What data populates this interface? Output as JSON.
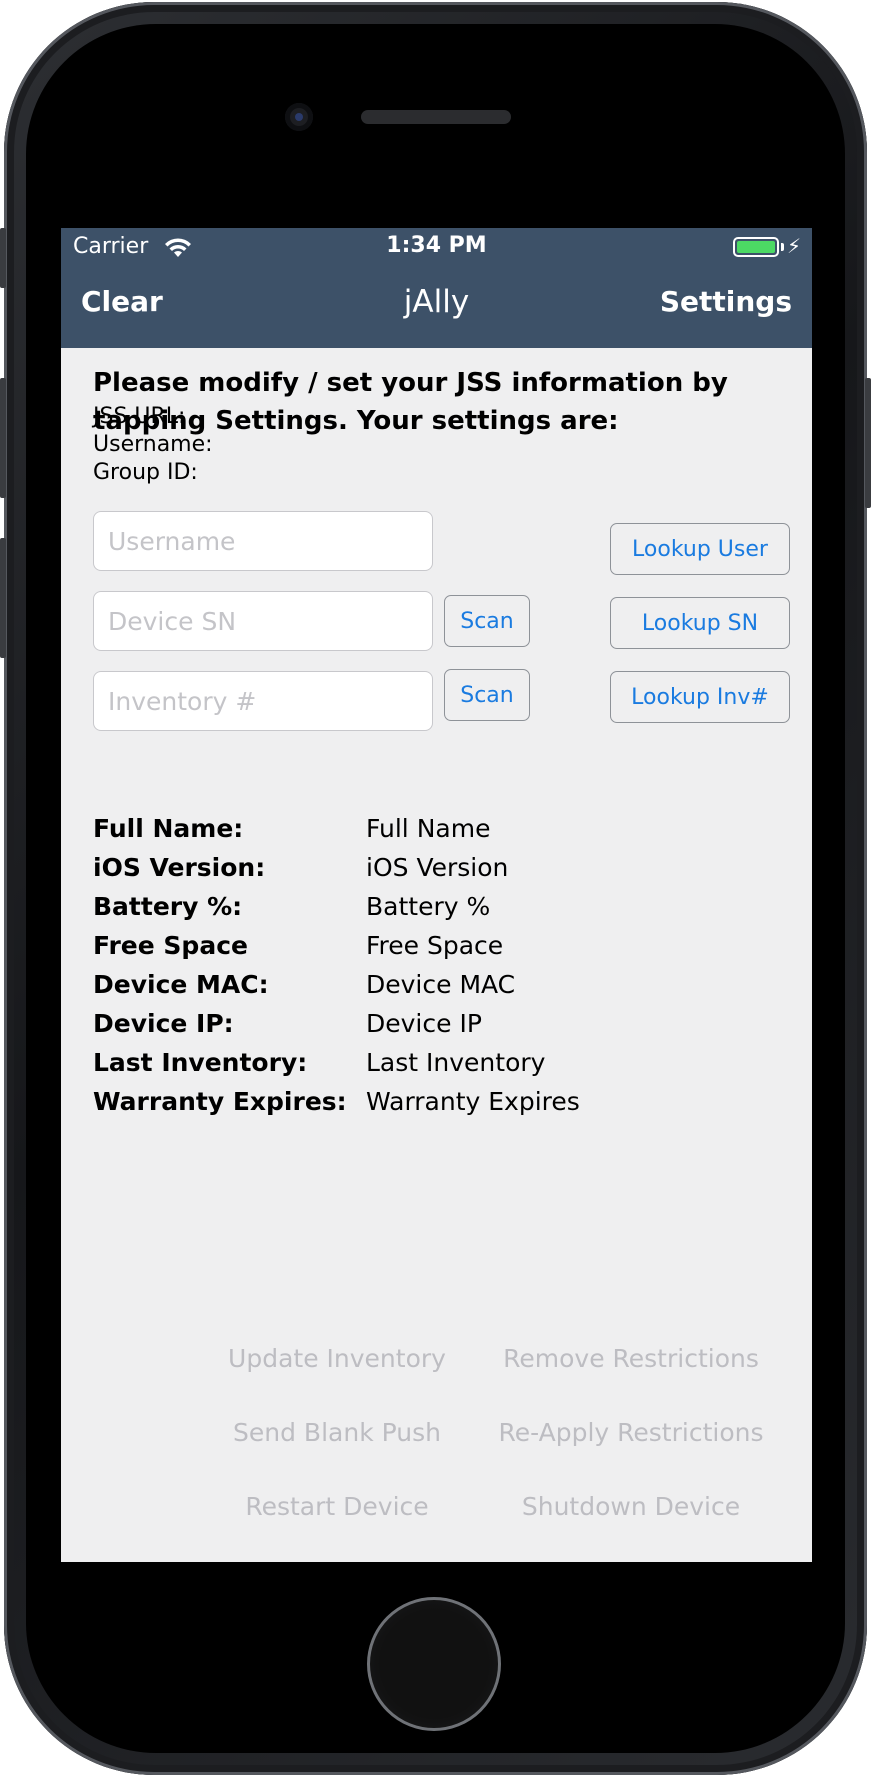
{
  "status_bar": {
    "carrier": "Carrier",
    "time": "1:34 PM",
    "battery_level": 1.0,
    "charging": true
  },
  "nav": {
    "left_button": "Clear",
    "title": "jAlly",
    "right_button": "Settings"
  },
  "intro": {
    "text": "Please modify / set your JSS information by tapping Settings. Your settings are:"
  },
  "settings": {
    "jss_url_label": "JSS URL:",
    "username_label": "Username:",
    "group_id_label": "Group ID:"
  },
  "lookup": {
    "username_placeholder": "Username",
    "device_sn_placeholder": "Device SN",
    "inventory_placeholder": "Inventory #",
    "scan_label": "Scan",
    "lookup_user_label": "Lookup User",
    "lookup_sn_label": "Lookup SN",
    "lookup_inv_label": "Lookup Inv#"
  },
  "device_info": [
    {
      "label": "Full Name:",
      "value": "Full Name"
    },
    {
      "label": "iOS Version:",
      "value": "iOS Version"
    },
    {
      "label": "Battery %:",
      "value": "Battery %"
    },
    {
      "label": "Free Space",
      "value": "Free Space"
    },
    {
      "label": "Device MAC:",
      "value": "Device MAC"
    },
    {
      "label": "Device IP:",
      "value": "Device IP"
    },
    {
      "label": "Last Inventory:",
      "value": "Last Inventory"
    },
    {
      "label": "Warranty Expires:",
      "value": "Warranty Expires"
    }
  ],
  "actions": {
    "update_inventory": "Update Inventory",
    "remove_restrictions": "Remove Restrictions",
    "send_blank_push": "Send Blank Push",
    "reapply_restrictions": "Re-Apply Restrictions",
    "restart_device": "Restart Device",
    "shutdown_device": "Shutdown Device"
  },
  "colors": {
    "nav_background": "#3d5168",
    "accent": "#1a7be0",
    "disabled_text": "#bdbdc2",
    "battery": "#4cd964"
  }
}
